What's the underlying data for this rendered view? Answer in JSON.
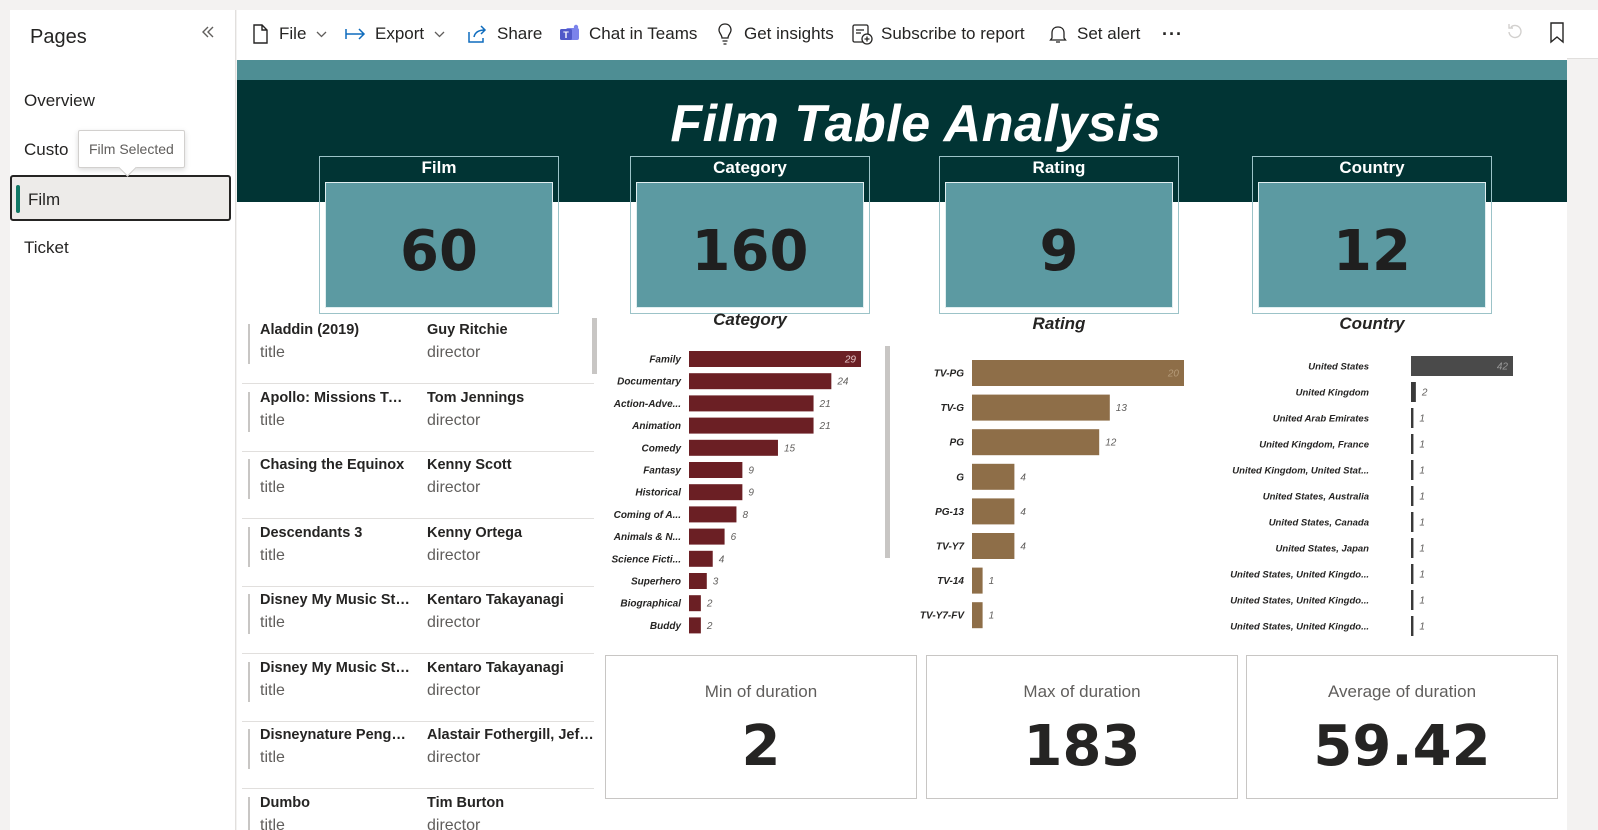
{
  "sidebar": {
    "title": "Pages",
    "items": [
      {
        "label": "Overview"
      },
      {
        "label": "Custo"
      },
      {
        "label": "Film"
      },
      {
        "label": "Ticket"
      }
    ],
    "tooltip": "Film Selected"
  },
  "toolbar": {
    "file": "File",
    "export": "Export",
    "share": "Share",
    "chat": "Chat in Teams",
    "insights": "Get insights",
    "subscribe": "Subscribe to report",
    "alert": "Set alert",
    "more": "···"
  },
  "report": {
    "title": "Film Table Analysis",
    "kpis": [
      {
        "label": "Film",
        "value": "60"
      },
      {
        "label": "Category",
        "value": "160"
      },
      {
        "label": "Rating",
        "value": "9"
      },
      {
        "label": "Country",
        "value": "12"
      }
    ],
    "table": {
      "rows": [
        {
          "title": "Aladdin (2019)",
          "title_label": "title",
          "director": "Guy Ritchie",
          "director_label": "director"
        },
        {
          "title": "Apollo: Missions To ...",
          "title_label": "title",
          "director": "Tom Jennings",
          "director_label": "director"
        },
        {
          "title": "Chasing the Equinox",
          "title_label": "title",
          "director": "Kenny Scott",
          "director_label": "director"
        },
        {
          "title": "Descendants 3",
          "title_label": "title",
          "director": "Kenny Ortega",
          "director_label": "director"
        },
        {
          "title": "Disney My Music Sto...",
          "title_label": "title",
          "director": "Kentaro Takayanagi",
          "director_label": "director"
        },
        {
          "title": "Disney My Music Sto...",
          "title_label": "title",
          "director": "Kentaro Takayanagi",
          "director_label": "director"
        },
        {
          "title": "Disneynature Pengui...",
          "title_label": "title",
          "director": "Alastair Fothergill, Jeff ...",
          "director_label": "director"
        },
        {
          "title": "Dumbo",
          "title_label": "title",
          "director": "Tim Burton",
          "director_label": "director"
        }
      ]
    },
    "cards": [
      {
        "label": "Min of duration",
        "value": "2"
      },
      {
        "label": "Max of duration",
        "value": "183"
      },
      {
        "label": "Average of duration",
        "value": "59.42"
      }
    ]
  },
  "chart_data": [
    {
      "type": "bar",
      "orientation": "horizontal",
      "title": "Category",
      "color": "#6b1f24",
      "categories": [
        "Family",
        "Documentary",
        "Action-Adve...",
        "Animation",
        "Comedy",
        "Fantasy",
        "Historical",
        "Coming of A...",
        "Animals & N...",
        "Science Ficti...",
        "Superhero",
        "Biographical",
        "Buddy"
      ],
      "values": [
        29,
        24,
        21,
        21,
        15,
        9,
        9,
        8,
        6,
        4,
        3,
        2,
        2
      ],
      "xlim": [
        0,
        29
      ]
    },
    {
      "type": "bar",
      "orientation": "horizontal",
      "title": "Rating",
      "color": "#8e6e48",
      "categories": [
        "TV-PG",
        "TV-G",
        "PG",
        "G",
        "PG-13",
        "TV-Y7",
        "TV-14",
        "TV-Y7-FV"
      ],
      "values": [
        20,
        13,
        12,
        4,
        4,
        4,
        1,
        1
      ],
      "xlim": [
        0,
        20
      ]
    },
    {
      "type": "bar",
      "orientation": "horizontal",
      "title": "Country",
      "color": "#4a4a4a",
      "categories": [
        "United States",
        "United Kingdom",
        "United Arab Emirates",
        "United Kingdom, France",
        "United Kingdom, United Stat...",
        "United States, Australia",
        "United States, Canada",
        "United States, Japan",
        "United States, United Kingdo...",
        "United States, United Kingdo...",
        "United States, United Kingdo..."
      ],
      "values": [
        42,
        2,
        1,
        1,
        1,
        1,
        1,
        1,
        1,
        1,
        1
      ],
      "xlim": [
        0,
        42
      ]
    }
  ]
}
